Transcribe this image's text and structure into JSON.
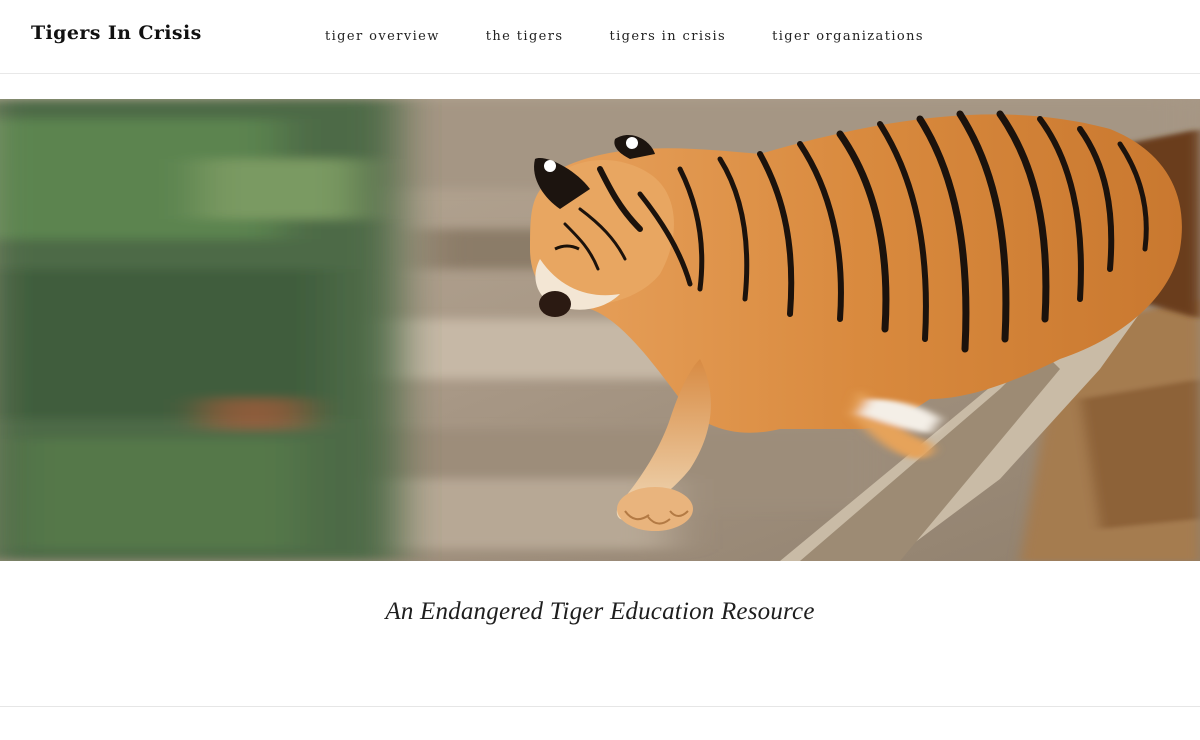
{
  "site": {
    "title": "Tigers In Crisis"
  },
  "nav": {
    "items": [
      {
        "label": "tiger overview"
      },
      {
        "label": "the tigers"
      },
      {
        "label": "tigers in crisis"
      },
      {
        "label": "tiger organizations"
      }
    ]
  },
  "hero": {
    "image": "tiger-running-photo"
  },
  "tagline": "An Endangered Tiger Education Resource"
}
